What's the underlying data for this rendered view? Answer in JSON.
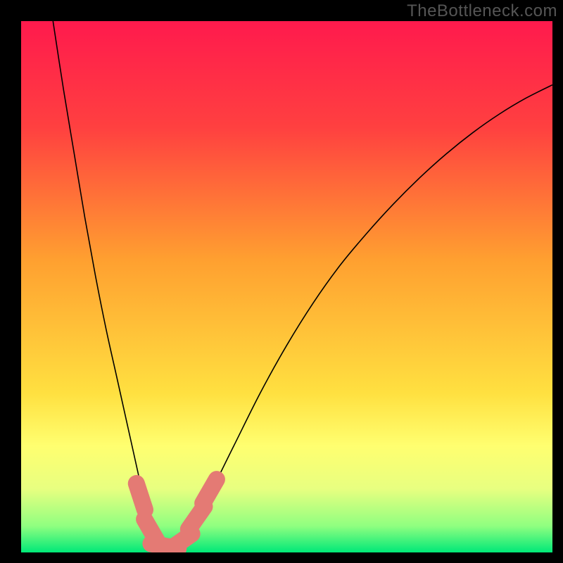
{
  "watermark": "TheBottleneck.com",
  "chart_data": {
    "type": "line",
    "title": "",
    "xlabel": "",
    "ylabel": "",
    "xlim": [
      0,
      100
    ],
    "ylim": [
      0,
      100
    ],
    "background_gradient": {
      "stops": [
        {
          "offset": 0.0,
          "color": "#ff1a4d"
        },
        {
          "offset": 0.2,
          "color": "#ff4040"
        },
        {
          "offset": 0.45,
          "color": "#ffa030"
        },
        {
          "offset": 0.7,
          "color": "#ffe040"
        },
        {
          "offset": 0.8,
          "color": "#ffff70"
        },
        {
          "offset": 0.88,
          "color": "#e8ff80"
        },
        {
          "offset": 0.95,
          "color": "#90ff80"
        },
        {
          "offset": 1.0,
          "color": "#00e878"
        }
      ]
    },
    "series": [
      {
        "name": "bottleneck-curve",
        "color": "#000000",
        "width": 1.6,
        "x": [
          6,
          8,
          10,
          12,
          14,
          16,
          18,
          20,
          22,
          23.5,
          25,
          27,
          29,
          30,
          32,
          35,
          40,
          45,
          50,
          55,
          60,
          65,
          70,
          75,
          80,
          85,
          90,
          95,
          100
        ],
        "y": [
          100,
          87,
          75,
          63,
          52,
          42,
          33,
          24,
          15,
          8,
          3,
          1,
          1,
          2,
          5,
          10,
          20,
          30,
          39,
          47,
          54,
          60,
          65.5,
          70.5,
          75,
          79,
          82.5,
          85.5,
          88
        ]
      }
    ],
    "markers": [
      {
        "name": "segment-a",
        "x": 22.5,
        "y": 10.5,
        "angle": -72
      },
      {
        "name": "segment-b",
        "x": 24.5,
        "y": 4.0,
        "angle": -60
      },
      {
        "name": "segment-c",
        "x": 27.0,
        "y": 1.2,
        "angle": -10
      },
      {
        "name": "segment-d",
        "x": 30.0,
        "y": 2.0,
        "angle": 35
      },
      {
        "name": "segment-e",
        "x": 33.0,
        "y": 6.5,
        "angle": 55
      },
      {
        "name": "segment-f",
        "x": 35.5,
        "y": 11.5,
        "angle": 60
      }
    ],
    "marker_style": {
      "color": "#e47a74",
      "length": 5.2,
      "thickness": 3.2,
      "cap": "round"
    }
  }
}
